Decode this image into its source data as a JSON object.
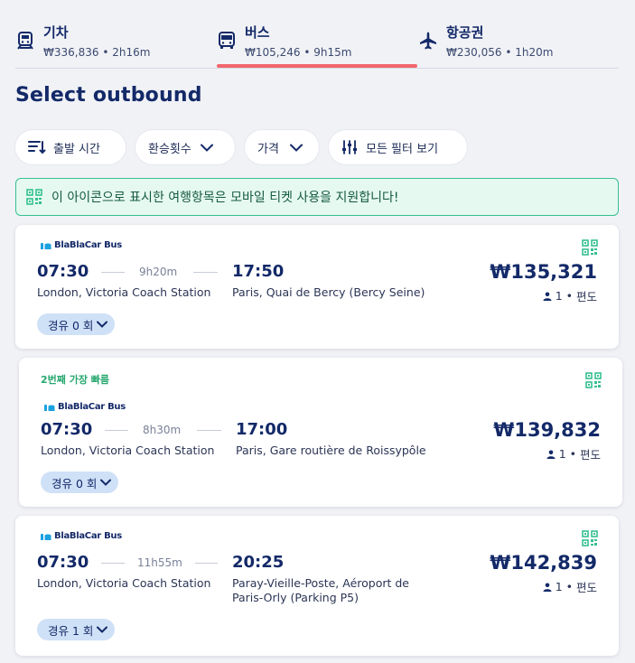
{
  "tabs": [
    {
      "title": "기차",
      "price": "₩336,836",
      "duration": "2h16m",
      "icon": "train-icon",
      "selected": false
    },
    {
      "title": "버스",
      "price": "₩105,246",
      "duration": "9h15m",
      "icon": "bus-icon",
      "selected": true
    },
    {
      "title": "항공권",
      "price": "₩230,056",
      "duration": "1h20m",
      "icon": "plane-icon",
      "selected": false
    }
  ],
  "tab_sub_separator": "•",
  "page_title": "Select outbound",
  "filters": {
    "departure_time": "출발 시간",
    "transfers": "환승횟수",
    "price": "가격",
    "all_filters": "모든 필터 보기"
  },
  "banner": {
    "text": "이 아이콘으로 표시한 여행항목은 모바일 티켓 사용을 지원합니다!",
    "icon": "qr-code-icon"
  },
  "results": [
    {
      "operator": "BlaBlaCar Bus",
      "tag": "",
      "departure_time": "07:30",
      "duration": "9h20m",
      "arrival_time": "17:50",
      "departure_station": "London, Victoria Coach Station",
      "arrival_station_line1": "Paris, Quai de Bercy (Bercy Seine)",
      "arrival_station_line2": "",
      "price": "₩135,321",
      "passengers": "1",
      "trip_type": "편도",
      "stops": "경유 0 회"
    },
    {
      "operator": "BlaBlaCar Bus",
      "tag": "2번째 가장 빠름",
      "departure_time": "07:30",
      "duration": "8h30m",
      "arrival_time": "17:00",
      "departure_station": "London, Victoria Coach Station",
      "arrival_station_line1": "Paris, Gare routière de Roissypôle",
      "arrival_station_line2": "",
      "price": "₩139,832",
      "passengers": "1",
      "trip_type": "편도",
      "stops": "경유 0 회"
    },
    {
      "operator": "BlaBlaCar Bus",
      "tag": "",
      "departure_time": "07:30",
      "duration": "11h55m",
      "arrival_time": "20:25",
      "departure_station": "London, Victoria Coach Station",
      "arrival_station_line1": "Paray-Vieille-Poste, Aéroport de",
      "arrival_station_line2": "Paris-Orly (Parking P5)",
      "price": "₩142,839",
      "passengers": "1",
      "trip_type": "편도",
      "stops": "경유 1 회"
    }
  ],
  "pax_separator": "•",
  "colors": {
    "primary_text": "#132968",
    "accent_underline": "#f2676d",
    "mobile_green": "#35c090",
    "stops_pill": "#cfe1f7"
  }
}
